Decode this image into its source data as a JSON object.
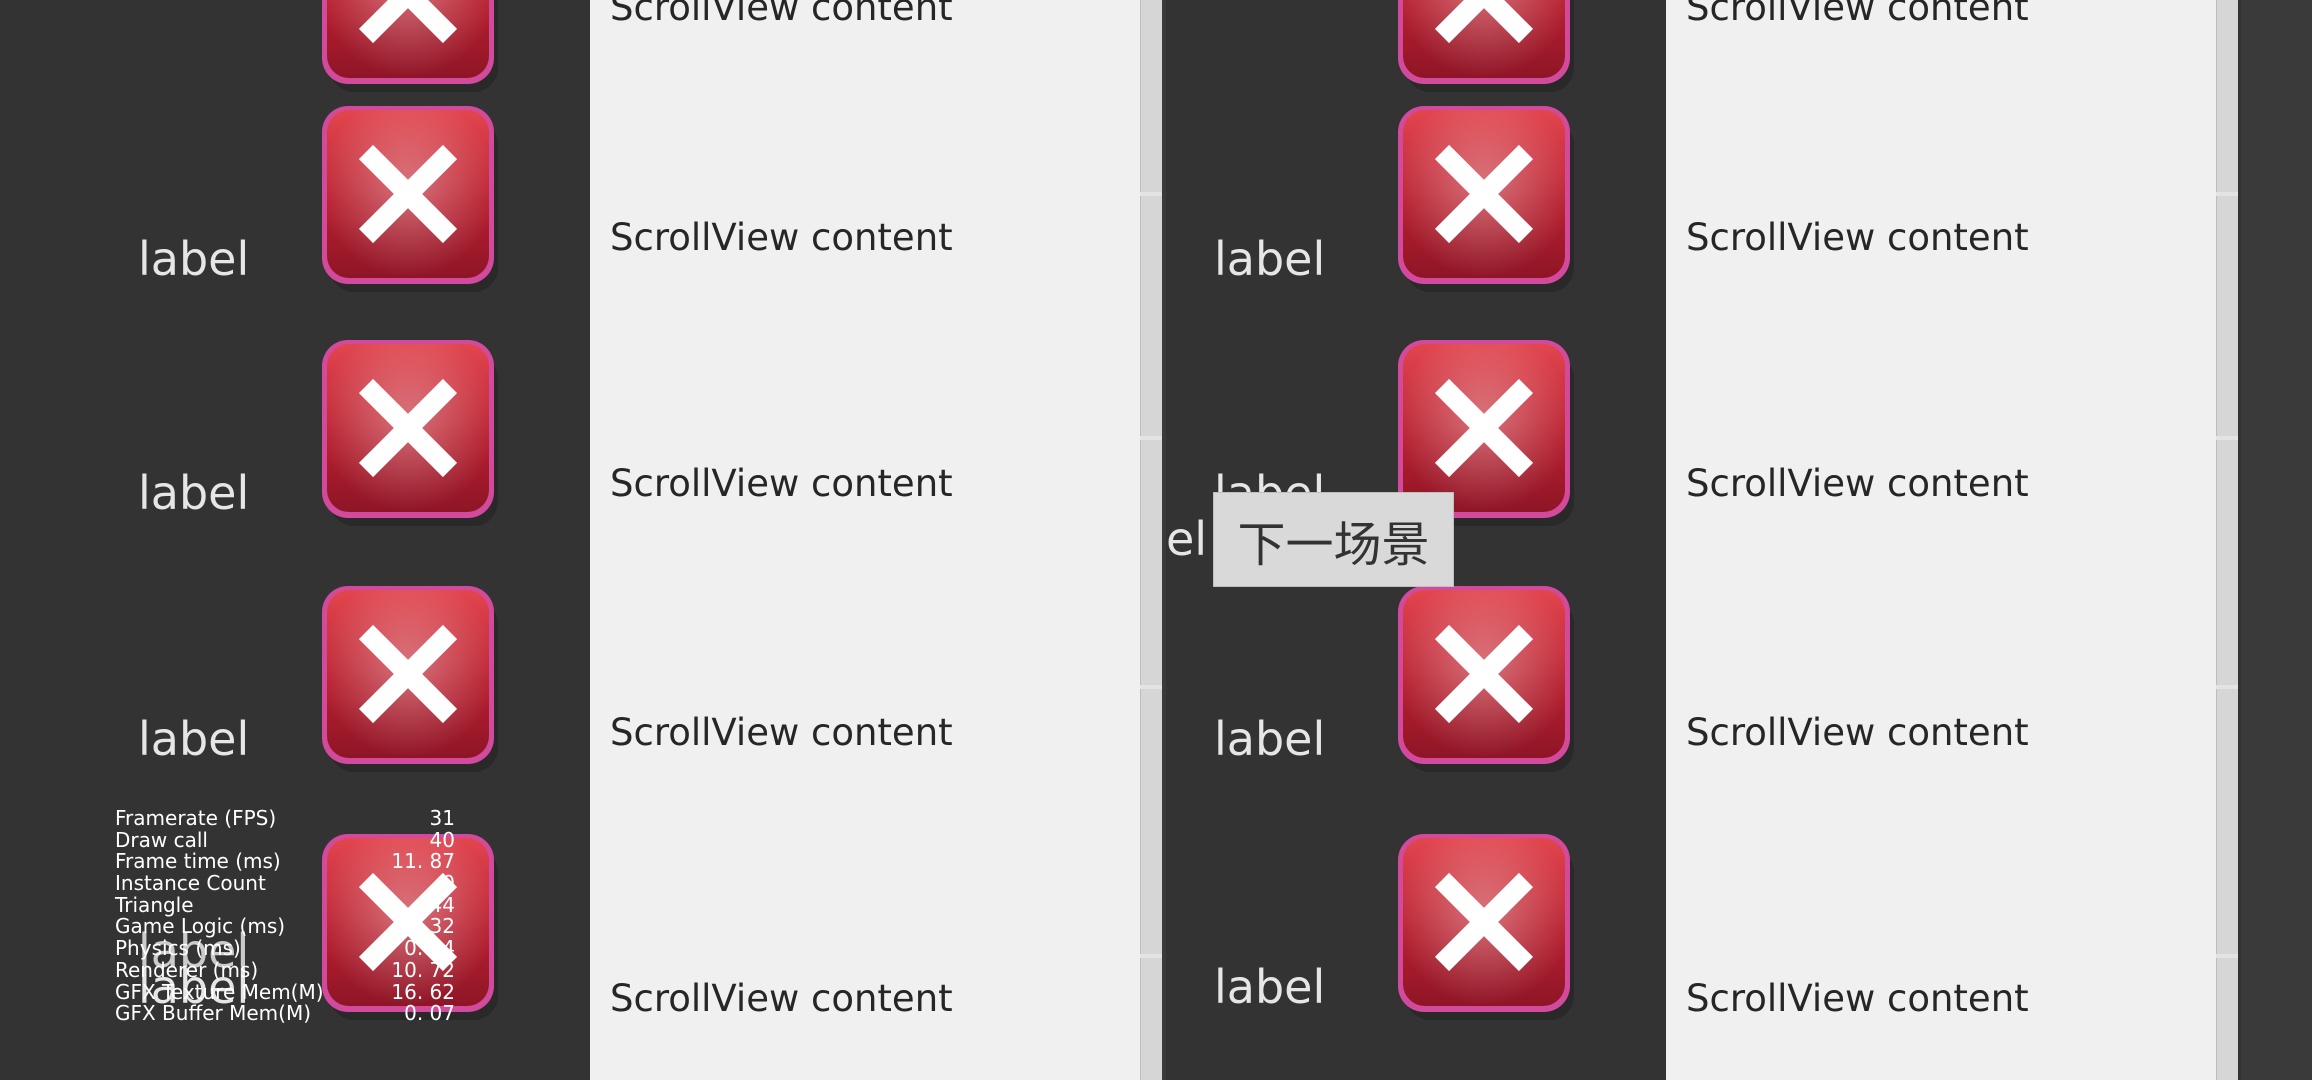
{
  "left_panel": {
    "labels": [
      "label",
      "label",
      "label",
      "label"
    ],
    "scroll_items": [
      "ScrollView content",
      "ScrollView content",
      "ScrollView content",
      "ScrollView content",
      "ScrollView content"
    ]
  },
  "right_panel": {
    "labels": [
      "label",
      "label",
      "label",
      "label"
    ],
    "scroll_items": [
      "ScrollView content",
      "ScrollView content",
      "ScrollView content",
      "ScrollView content",
      "ScrollView content"
    ],
    "partial_label": "el"
  },
  "next_scene_button": "下一场景",
  "stats": [
    {
      "name": "Framerate (FPS)",
      "value": "31"
    },
    {
      "name": "Draw call",
      "value": "40"
    },
    {
      "name": "Frame time (ms)",
      "value": "11. 87"
    },
    {
      "name": "Instance Count",
      "value": "0"
    },
    {
      "name": "Triangle",
      "value": "844"
    },
    {
      "name": "Game Logic (ms)",
      "value": "0. 32"
    },
    {
      "name": "Physics (ms)",
      "value": "0. 04"
    },
    {
      "name": "Renderer (ms)",
      "value": "10. 72"
    },
    {
      "name": "GFX Texture Mem(M)",
      "value": "16. 62"
    },
    {
      "name": "GFX Buffer Mem(M)",
      "value": "0. 07"
    }
  ],
  "overlay_label": "label",
  "colors": {
    "background": "#333333",
    "scroll_bg": "#f0f0f0",
    "button_red": "#c1283a",
    "button_rim": "#e85fb0"
  },
  "icons": {
    "close": "close-x-icon"
  }
}
